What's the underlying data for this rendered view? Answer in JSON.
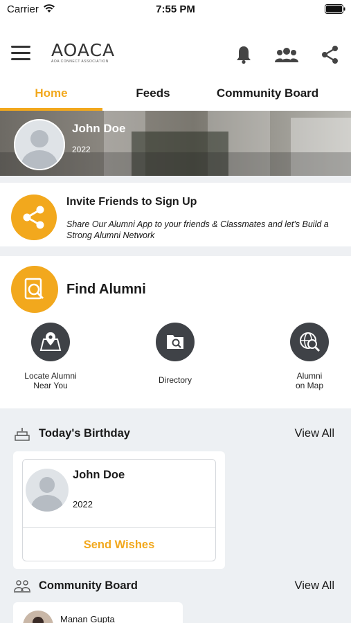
{
  "status_bar": {
    "carrier": "Carrier",
    "time": "7:55 PM"
  },
  "app_bar": {
    "logo_title": "AOACA",
    "logo_subtitle": "AOA CONNECT ASSOCIATION",
    "icons": [
      "menu-icon",
      "bell-icon",
      "group-icon",
      "share-icon"
    ]
  },
  "tabs": [
    {
      "label": "Home",
      "active": true
    },
    {
      "label": "Feeds",
      "active": false
    },
    {
      "label": "Community Board",
      "active": false
    }
  ],
  "profile": {
    "name": "John Doe",
    "year": "2022"
  },
  "invite": {
    "title": "Invite Friends to Sign Up",
    "description": "Share Our Alumni App to your friends & Classmates and let's Build a Strong Alumni Network"
  },
  "find_alumni": {
    "title": "Find Alumni",
    "features": [
      {
        "label": "Locate Alumni\nNear You",
        "icon": "map-pin-icon"
      },
      {
        "label": "Directory",
        "icon": "directory-search-icon"
      },
      {
        "label": "Alumni\non Map",
        "icon": "globe-search-icon"
      }
    ]
  },
  "birthday": {
    "title": "Today's Birthday",
    "view_all": "View All",
    "card": {
      "name": "John Doe",
      "year": "2022",
      "action": "Send Wishes"
    }
  },
  "community": {
    "title": "Community Board",
    "view_all": "View All",
    "first_post_author": "Manan Gupta"
  },
  "colors": {
    "accent": "#f2a81d",
    "icon_dark": "#3f4247",
    "section_bg": "#edf0f3"
  }
}
